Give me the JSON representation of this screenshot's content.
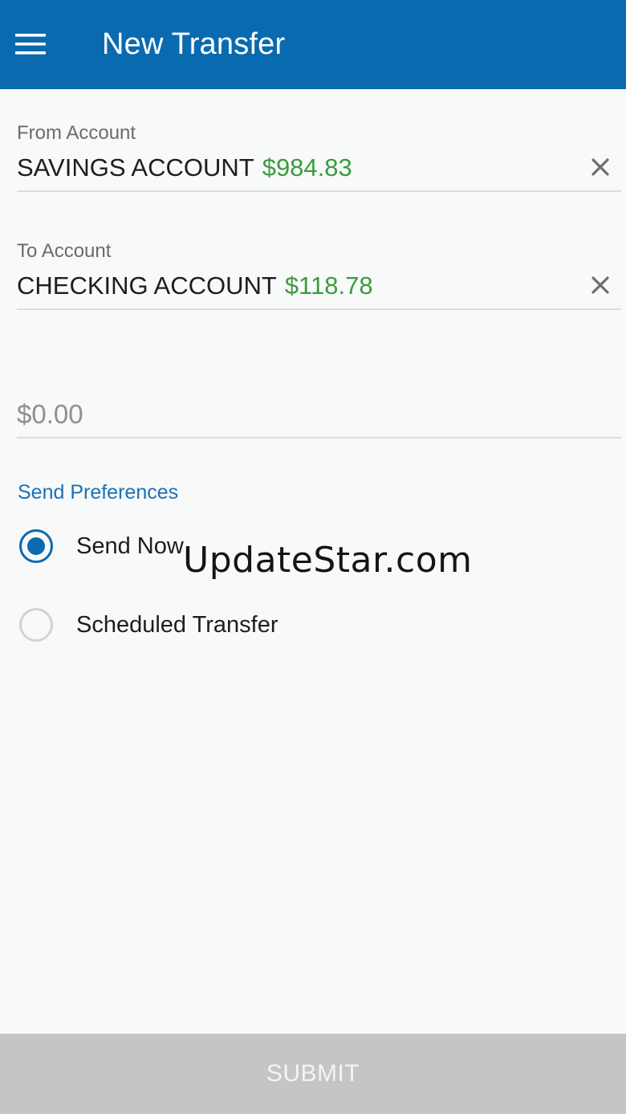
{
  "appbar": {
    "title": "New Transfer",
    "menu_icon": "hamburger-menu-icon",
    "color": "#0a6ab0"
  },
  "from_account": {
    "label": "From Account",
    "name": "SAVINGS ACCOUNT",
    "balance": "$984.83",
    "clear_icon": "close-icon"
  },
  "to_account": {
    "label": "To Account",
    "name": "CHECKING ACCOUNT",
    "balance": "$118.78",
    "clear_icon": "close-icon"
  },
  "amount": {
    "placeholder": "$0.00",
    "value": ""
  },
  "send_preferences": {
    "title": "Send Preferences",
    "options": [
      {
        "label": "Send Now",
        "selected": true
      },
      {
        "label": "Scheduled Transfer",
        "selected": false
      }
    ]
  },
  "watermark": "UpdateStar.com",
  "submit": {
    "label": "SUBMIT",
    "disabled": true
  },
  "colors": {
    "primary": "#0a6ab0",
    "balance_green": "#3c9b3f",
    "section_blue": "#1a72b8",
    "disabled_button": "#c3c5c7"
  }
}
